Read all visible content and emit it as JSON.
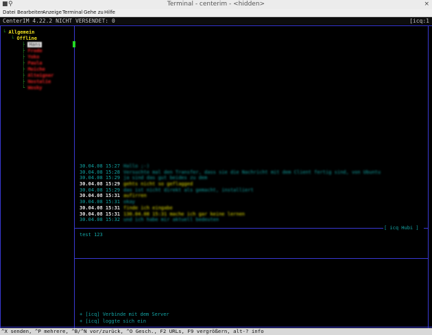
{
  "window": {
    "title": "Terminal - centerim - <hidden>",
    "close_glyph": "×"
  },
  "menu": [
    "Datei",
    "Bearbeiten",
    "Anzeige",
    "Terminal",
    "Gehe zu",
    "Hilfe"
  ],
  "status": {
    "left": "CenterIM 4.22.2  NICHT VERSENDET: 0",
    "right": "[icq:1"
  },
  "tree": {
    "root": "Allgemein",
    "group": "Offline",
    "selected_contact": "Hans",
    "contacts": [
      "Frodo",
      "Yoko",
      "Paula",
      "Moiche",
      "Alteigner",
      "Nostalie",
      "Wosky"
    ]
  },
  "history": [
    {
      "ts": "30.04.08 15:27",
      "dir": "in",
      "msg": "Hallo ;-)"
    },
    {
      "ts": "30.04.08 15:28",
      "dir": "in",
      "msg": "Versuchte mal den Transfer, dass sie die Nachricht mit dem Client fertig sind, von Ubuntu"
    },
    {
      "ts": "30.04.08 15:29",
      "dir": "in",
      "msg": "ja sind das gut beides zu dem"
    },
    {
      "ts": "30.04.08 15:29",
      "dir": "out",
      "msg": "gehts nicht so geflagged"
    },
    {
      "ts": "30.04.08 15:29",
      "dir": "in",
      "msg": "das ist nicht direkt als gemacht, installiert"
    },
    {
      "ts": "30.04.08 15:31",
      "dir": "out",
      "msg": "aufirren"
    },
    {
      "ts": "30.04.08 15:31",
      "dir": "in",
      "msg": "okay"
    },
    {
      "ts": "30.04.08 15:31",
      "dir": "out",
      "msg": "finde ich eingabe"
    },
    {
      "ts": "30.04.08 15:31",
      "dir": "out",
      "msg": "130.04.08 15:31 mache ich gar keine lernen"
    },
    {
      "ts": "30.04.08 15:32",
      "dir": "in",
      "msg": "und ich habe mir aktuell bedeuten"
    }
  ],
  "peer_label": "[ icq Hubi ]",
  "input_text": "test 123",
  "log": [
    "+ [icq] Verbinde mit dem Server",
    "+ [icq] loggte sich ein"
  ],
  "bottombar": "^X senden, ^P mehrere, ^B/^N vor/zurück, ^O Gesch., F2 URLs, F9 vergrößern, alt-? info"
}
